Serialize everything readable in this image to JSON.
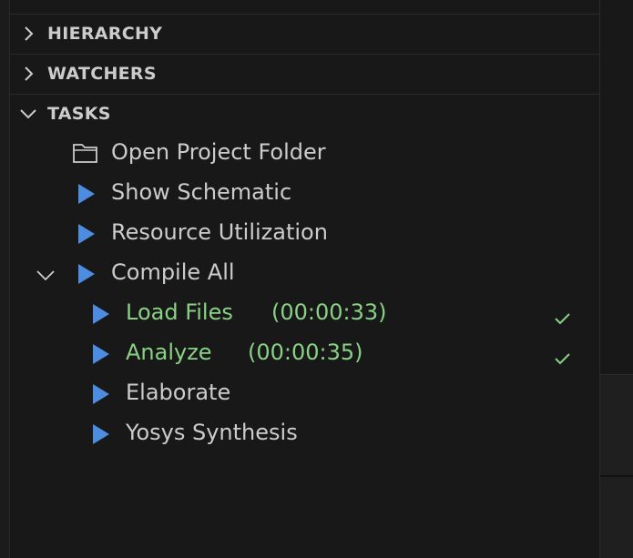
{
  "sections": {
    "hierarchy": {
      "label": "HIERARCHY"
    },
    "watchers": {
      "label": "WATCHERS"
    },
    "tasks": {
      "label": "TASKS"
    }
  },
  "tasks": {
    "open_project_folder": {
      "label": "Open Project Folder",
      "icon": "folder-icon"
    },
    "show_schematic": {
      "label": "Show Schematic",
      "icon": "play-icon"
    },
    "resource_utilization": {
      "label": "Resource Utilization",
      "icon": "play-icon"
    },
    "compile_all": {
      "label": "Compile All",
      "icon": "play-icon",
      "expanded": true,
      "children": [
        {
          "label": "Load Files",
          "time": "(00:00:33)",
          "status": "completed"
        },
        {
          "label": "Analyze",
          "time": "(00:00:35)",
          "status": "completed"
        },
        {
          "label": "Elaborate",
          "time": "",
          "status": "pending"
        },
        {
          "label": "Yosys Synthesis",
          "time": "",
          "status": "pending"
        }
      ]
    }
  },
  "colors": {
    "background": "#181818",
    "text": "#cccccc",
    "success_green": "#89d185",
    "play_blue": "#4d8cde",
    "divider": "#2b2b2b"
  }
}
